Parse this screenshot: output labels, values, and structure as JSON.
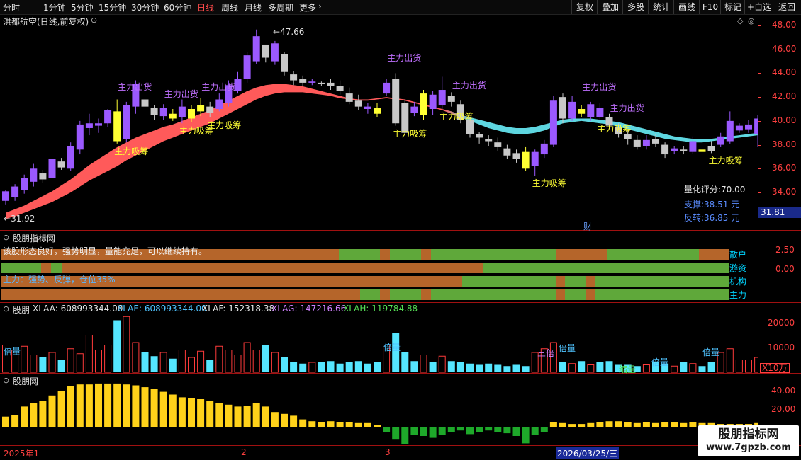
{
  "toolbar": {
    "periods": [
      "分时",
      "1分钟",
      "5分钟",
      "15分钟",
      "30分钟",
      "60分钟",
      "日线",
      "周线",
      "月线",
      "多周期",
      "更多"
    ],
    "active": "日线",
    "right_buttons": [
      "复权",
      "叠加",
      "多股",
      "统计",
      "画线",
      "F10",
      "标记",
      "+自选",
      "返回"
    ]
  },
  "main_panel": {
    "title": "洪都航空(日线,前复权)",
    "high_label": "47.66",
    "low_label": "31.92",
    "y_ticks": [
      "48.00",
      "46.00",
      "44.00",
      "42.00",
      "40.00",
      "38.00",
      "36.00",
      "34.00"
    ],
    "price_tag": "31.81",
    "score_label": "量化评分:70.00",
    "support_label": "支撑:38.51 元",
    "reversal_label": "反转:36.85 元",
    "fin_marker": "财",
    "signal_sell": "主力出货",
    "signal_buy": "主力吸筹"
  },
  "indicator_panel": {
    "title": "股朋指标网",
    "desc_line1": "该股形态良好，强势明显，量能充足，可以继续持有。",
    "desc_line2": "主力：强势、反弹，仓位35%",
    "rows": [
      "散户",
      "游资",
      "机构",
      "主力"
    ],
    "y_ticks": [
      "2.50",
      "0.00"
    ]
  },
  "volume_panel": {
    "title": "股朋",
    "xlaa": "XLAA: 608993344.00",
    "xlae": "XLAE: 608993344.00",
    "xlaf": "XLAF: 152318.38",
    "xlag": "XLAG: 147216.66",
    "xlah": "XLAH: 119784.88",
    "y_ticks": [
      "20000",
      "10000"
    ],
    "unit": "X10万",
    "label_double": "倍量",
    "label_shrink": "缩量",
    "label_three": "三倍"
  },
  "osc_panel": {
    "title": "股朋网",
    "y_ticks": [
      "40.00",
      "20.00"
    ]
  },
  "date_axis": {
    "labels": [
      "2025年1",
      "2",
      "3"
    ],
    "cursor_date": "2026/03/25/三"
  },
  "watermark": {
    "line1": "股朋指标网",
    "line2": "www.7gpzb.com"
  },
  "colors": {
    "up": "#9b59ff",
    "down": "#c8c8c8",
    "yellow": "#ffff33",
    "ribbon_red": "#ff5a5a",
    "ribbon_cyan": "#5ed6e0",
    "axis_red": "#ff4040"
  },
  "candles": [
    [
      33.3,
      34.1,
      33.0,
      34.2
    ],
    [
      33.6,
      34.5,
      33.3,
      34.7
    ],
    [
      34.2,
      35.2,
      33.9,
      35.5
    ],
    [
      34.9,
      36.0,
      34.5,
      36.4
    ],
    [
      35.6,
      35.1,
      34.8,
      35.9
    ],
    [
      35.2,
      36.8,
      35.0,
      37.0
    ],
    [
      36.6,
      36.1,
      35.9,
      36.9
    ],
    [
      36.0,
      37.9,
      35.8,
      38.2
    ],
    [
      37.6,
      39.7,
      37.2,
      40.0
    ],
    [
      39.4,
      39.8,
      38.8,
      40.6
    ],
    [
      39.6,
      39.8,
      39.0,
      40.2
    ],
    [
      39.8,
      40.9,
      39.5,
      41.0
    ],
    [
      40.8,
      38.3,
      38.1,
      41.8
    ],
    [
      38.5,
      41.3,
      38.2,
      41.6
    ],
    [
      41.2,
      43.1,
      40.6,
      43.4
    ],
    [
      41.8,
      41.2,
      40.8,
      42.2
    ],
    [
      41.1,
      40.5,
      40.1,
      41.3
    ],
    [
      40.4,
      41.1,
      40.1,
      41.4
    ],
    [
      40.6,
      40.2,
      40.0,
      41.0
    ],
    [
      40.3,
      41.2,
      39.8,
      41.8
    ],
    [
      40.2,
      41.0,
      39.9,
      41.3
    ],
    [
      40.8,
      41.3,
      40.4,
      41.9
    ],
    [
      41.2,
      40.7,
      40.3,
      41.6
    ],
    [
      41.0,
      41.8,
      40.8,
      42.3
    ],
    [
      41.5,
      43.0,
      41.2,
      43.4
    ],
    [
      42.5,
      43.5,
      42.3,
      44.1
    ],
    [
      43.5,
      45.5,
      43.2,
      45.8
    ],
    [
      45.0,
      47.1,
      44.8,
      47.66
    ],
    [
      46.4,
      45.3,
      44.9,
      46.4
    ],
    [
      45.0,
      46.5,
      44.7,
      46.7
    ],
    [
      45.6,
      44.1,
      43.8,
      45.8
    ],
    [
      43.9,
      43.4,
      43.0,
      44.2
    ],
    [
      43.5,
      43.2,
      42.9,
      43.8
    ],
    [
      43.2,
      43.3,
      43.0,
      43.5
    ],
    [
      43.2,
      43.1,
      42.9,
      43.3
    ],
    [
      43.2,
      42.9,
      42.6,
      43.5
    ],
    [
      42.9,
      42.5,
      42.2,
      43.4
    ],
    [
      42.3,
      41.6,
      41.4,
      42.8
    ],
    [
      41.7,
      41.2,
      40.9,
      42.2
    ],
    [
      41.2,
      41.0,
      40.6,
      41.5
    ],
    [
      41.1,
      40.6,
      40.3,
      41.5
    ],
    [
      42.3,
      43.2,
      42.1,
      43.5
    ],
    [
      43.5,
      39.8,
      39.6,
      44.0
    ],
    [
      41.5,
      39.0,
      38.8,
      41.8
    ],
    [
      41.2,
      40.7,
      40.4,
      41.6
    ],
    [
      40.5,
      42.3,
      40.1,
      42.6
    ],
    [
      42.2,
      41.0,
      40.5,
      42.5
    ],
    [
      41.3,
      42.6,
      41.0,
      43.7
    ],
    [
      42.1,
      41.6,
      41.2,
      42.4
    ],
    [
      41.4,
      40.1,
      39.8,
      41.7
    ],
    [
      40.1,
      38.9,
      38.6,
      40.3
    ],
    [
      38.9,
      38.6,
      38.1,
      39.1
    ],
    [
      38.5,
      38.3,
      37.9,
      38.8
    ],
    [
      38.2,
      37.8,
      37.5,
      38.6
    ],
    [
      37.7,
      37.1,
      36.8,
      38.0
    ],
    [
      37.3,
      36.8,
      36.5,
      37.6
    ],
    [
      37.4,
      36.0,
      35.8,
      37.8
    ],
    [
      36.2,
      37.4,
      35.4,
      37.6
    ],
    [
      37.2,
      38.1,
      36.9,
      38.4
    ],
    [
      38.0,
      41.7,
      37.8,
      42.1
    ],
    [
      42.0,
      40.2,
      39.8,
      42.3
    ],
    [
      40.2,
      41.6,
      40.0,
      42.1
    ],
    [
      41.0,
      40.6,
      40.3,
      41.3
    ],
    [
      40.3,
      41.4,
      40.0,
      41.6
    ],
    [
      41.1,
      40.3,
      40.0,
      41.5
    ],
    [
      40.3,
      39.6,
      39.3,
      40.6
    ],
    [
      39.5,
      38.9,
      38.6,
      39.8
    ],
    [
      38.9,
      38.5,
      38.0,
      39.2
    ],
    [
      38.4,
      37.8,
      37.6,
      38.8
    ],
    [
      37.9,
      38.4,
      37.6,
      38.8
    ],
    [
      38.5,
      38.1,
      37.8,
      38.9
    ],
    [
      38.0,
      37.2,
      36.9,
      38.2
    ],
    [
      37.5,
      37.7,
      37.2,
      37.9
    ],
    [
      37.6,
      37.5,
      37.2,
      37.9
    ],
    [
      37.4,
      38.3,
      37.2,
      38.7
    ],
    [
      37.6,
      37.4,
      37.1,
      37.9
    ],
    [
      37.9,
      37.5,
      37.3,
      38.3
    ],
    [
      38.0,
      38.7,
      37.8,
      39.0
    ],
    [
      38.3,
      40.0,
      38.1,
      40.8
    ],
    [
      39.2,
      39.6,
      39.0,
      39.8
    ],
    [
      39.3,
      39.7,
      39.0,
      40.1
    ],
    [
      38.9,
      40.2,
      37.8,
      40.5
    ]
  ],
  "ribbon_top": [
    32.3,
    32.6,
    32.9,
    33.3,
    33.7,
    34.1,
    34.6,
    35.1,
    35.7,
    36.3,
    36.8,
    37.3,
    37.8,
    38.2,
    38.6,
    38.9,
    39.2,
    39.5,
    39.7,
    40.0,
    40.3,
    40.6,
    40.9,
    41.3,
    41.7,
    42.1,
    42.5,
    42.8,
    43.0,
    43.1,
    43.1,
    43.0,
    42.9,
    42.7,
    42.5,
    42.3,
    42.1,
    41.9,
    41.8,
    41.8,
    41.9,
    42.0,
    41.9,
    41.8,
    41.6,
    41.4,
    41.2,
    41.0,
    40.8,
    40.5,
    40.3,
    40.1,
    39.9,
    39.7,
    39.5,
    39.4,
    39.4,
    39.5,
    39.7,
    39.9,
    40.1,
    40.2,
    40.2,
    40.2,
    40.1,
    40.0,
    39.9,
    39.7,
    39.5,
    39.3,
    39.1,
    38.9,
    38.7,
    38.6,
    38.5,
    38.5,
    38.5,
    38.6,
    38.7,
    38.8,
    38.9,
    39.0
  ],
  "ribbon_bot": [
    31.8,
    32.0,
    32.3,
    32.6,
    32.9,
    33.2,
    33.6,
    34.0,
    34.5,
    35.0,
    35.4,
    35.8,
    36.2,
    36.7,
    37.1,
    37.5,
    37.9,
    38.3,
    38.6,
    38.9,
    39.2,
    39.5,
    39.8,
    40.2,
    40.6,
    41.0,
    41.4,
    41.8,
    42.1,
    42.3,
    42.4,
    42.4,
    42.4,
    42.3,
    42.2,
    42.1,
    41.9,
    41.8,
    41.7,
    41.7,
    41.8,
    41.9,
    41.8,
    41.7,
    41.5,
    41.3,
    41.1,
    40.9,
    40.6,
    40.3,
    40.0,
    39.7,
    39.4,
    39.2,
    39.0,
    38.9,
    38.9,
    39.0,
    39.2,
    39.5,
    39.8,
    39.9,
    40.0,
    39.9,
    39.8,
    39.7,
    39.5,
    39.3,
    39.1,
    38.9,
    38.7,
    38.5,
    38.4,
    38.3,
    38.2,
    38.2,
    38.3,
    38.4,
    38.5,
    38.6,
    38.7,
    38.8
  ],
  "volume": [
    11000,
    9000,
    10500,
    7000,
    6000,
    8000,
    5000,
    9500,
    7500,
    15000,
    9000,
    11000,
    21000,
    22500,
    12000,
    8000,
    6500,
    8000,
    5500,
    9000,
    6000,
    8500,
    5000,
    10500,
    9000,
    7000,
    12000,
    9000,
    11000,
    8000,
    6000,
    4000,
    3500,
    4000,
    4000,
    4500,
    3500,
    4000,
    4500,
    3500,
    4000,
    11000,
    16000,
    8000,
    4500,
    7000,
    4000,
    6500,
    4500,
    4000,
    3500,
    3000,
    3500,
    3000,
    2500,
    3000,
    2500,
    8000,
    9500,
    12000,
    4000,
    3500,
    4500,
    3000,
    4000,
    4500,
    3000,
    3000,
    2500,
    3000,
    4000,
    3500,
    2500,
    4000,
    3500,
    2500,
    4000,
    8000,
    9500,
    5000,
    5000,
    6000
  ],
  "osc": [
    11,
    13,
    22,
    26,
    28,
    34,
    39,
    44,
    46,
    46,
    47,
    47,
    47,
    46,
    45,
    43,
    41,
    38,
    35,
    32,
    31,
    30,
    28,
    26,
    24,
    22,
    23,
    26,
    22,
    16,
    14,
    12,
    8,
    6,
    5,
    6,
    5,
    5,
    4,
    4,
    2,
    -6,
    -14,
    -19,
    -9,
    -10,
    -12,
    -9,
    -6,
    -4,
    -8,
    -6,
    -4,
    -6,
    -7,
    -10,
    -18,
    -9,
    -6,
    5,
    4,
    3,
    3,
    4,
    5,
    6,
    6,
    5,
    4,
    5,
    4,
    5,
    5,
    4,
    5,
    4,
    4,
    3,
    3,
    3,
    3,
    4
  ],
  "sell_signals": [
    [
      13,
      "主力出货"
    ],
    [
      18,
      "主力出货"
    ],
    [
      22,
      "主力出货"
    ],
    [
      42,
      "主力出货"
    ],
    [
      49,
      "主力出货"
    ],
    [
      63,
      "主力出货"
    ],
    [
      66,
      "主力出货"
    ]
  ],
  "buy_signals": [
    [
      12,
      "主力吸筹"
    ],
    [
      19,
      "主力吸筹"
    ],
    [
      22,
      "主力吸筹"
    ],
    [
      42,
      "主力吸筹"
    ],
    [
      47,
      "主力吸筹"
    ],
    [
      57,
      "主力吸筹"
    ],
    [
      64,
      "主力吸筹"
    ],
    [
      76,
      "主力吸筹"
    ]
  ],
  "yellow_idx": [
    12,
    18,
    20,
    21,
    40,
    45,
    56,
    62,
    75
  ],
  "purple_idx": [
    13,
    26,
    27,
    29,
    39,
    44,
    46,
    59,
    61,
    63,
    64,
    78
  ],
  "band_rows": [
    [
      [
        0,
        477,
        "#b5652a"
      ],
      [
        477,
        535,
        "#5fa83a"
      ],
      [
        535,
        549,
        "#b5652a"
      ],
      [
        549,
        593,
        "#5fa83a"
      ],
      [
        593,
        607,
        "#b5652a"
      ],
      [
        607,
        783,
        "#5fa83a"
      ],
      [
        783,
        855,
        "#b5652a"
      ],
      [
        855,
        985,
        "#5fa83a"
      ],
      [
        985,
        1027,
        "#b5652a"
      ]
    ],
    [
      [
        0,
        57,
        "#5fa83a"
      ],
      [
        57,
        71,
        "#b5652a"
      ],
      [
        71,
        87,
        "#5fa83a"
      ],
      [
        87,
        680,
        "#b5652a"
      ],
      [
        680,
        838,
        "#5fa83a"
      ],
      [
        838,
        1027,
        "#5fa83a"
      ]
    ],
    [
      [
        0,
        651,
        "#b5652a"
      ],
      [
        651,
        783,
        "#5fa83a"
      ],
      [
        783,
        796,
        "#b5652a"
      ],
      [
        796,
        825,
        "#5fa83a"
      ],
      [
        825,
        838,
        "#b5652a"
      ],
      [
        838,
        1027,
        "#5fa83a"
      ]
    ],
    [
      [
        0,
        507,
        "#b5652a"
      ],
      [
        507,
        535,
        "#5fa83a"
      ],
      [
        535,
        549,
        "#b5652a"
      ],
      [
        549,
        593,
        "#5fa83a"
      ],
      [
        593,
        607,
        "#b5652a"
      ],
      [
        607,
        783,
        "#5fa83a"
      ],
      [
        783,
        796,
        "#b5652a"
      ],
      [
        796,
        825,
        "#5fa83a"
      ],
      [
        825,
        838,
        "#b5652a"
      ],
      [
        838,
        1027,
        "#5fa83a"
      ]
    ]
  ]
}
